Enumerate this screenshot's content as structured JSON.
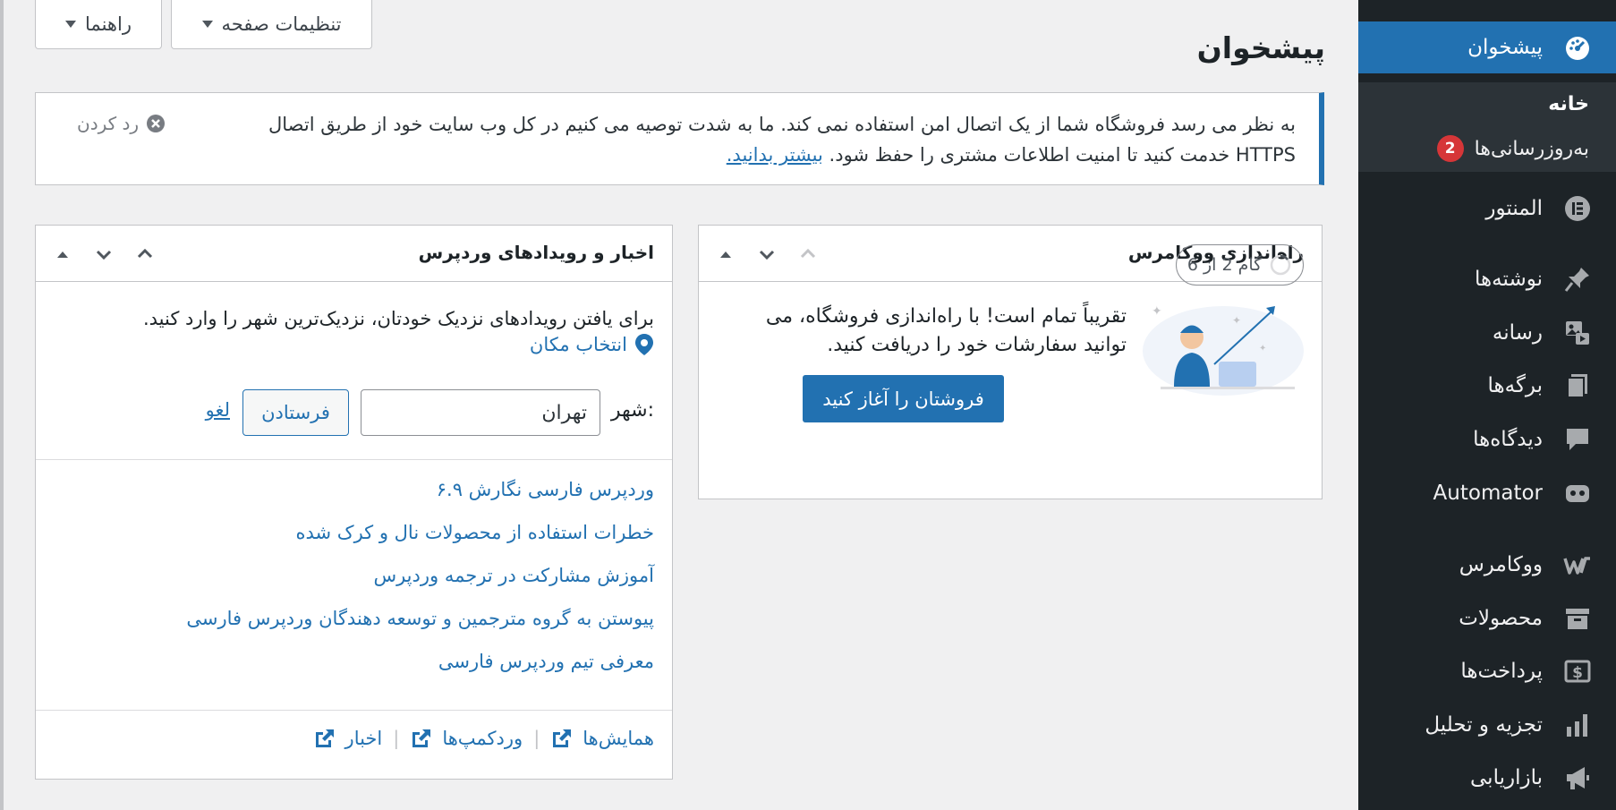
{
  "screen_tabs": {
    "help": "راهنما",
    "screen_options": "تنظیمات صفحه"
  },
  "page_title": "پیشخوان",
  "notice": {
    "line1": "به نظر می رسد فروشگاه شما از یک اتصال امن استفاده نمی کند. ما به شدت توصیه می کنیم در کل وب سایت خود از طریق اتصال",
    "line2": "HTTPS خدمت کنید تا امنیت اطلاعات مشتری را حفظ شود.",
    "learn_more": "بیشتر بدانید.",
    "dismiss": "رد کردن"
  },
  "woo_setup": {
    "title": "راه‌اندازی ووکامرس",
    "step": "گام 2 از 6",
    "message": "تقریباً تمام است! با راه‌اندازی فروشگاه، می توانید سفارشات خود را دریافت کنید.",
    "button": "فروشتان را آغاز کنید"
  },
  "events": {
    "title": "اخبار و رویدادهای وردپرس",
    "intro": "برای یافتن رویدادهای نزدیک خودتان، نزدیک‌ترین شهر را وارد کنید.",
    "choose_location": "انتخاب مکان",
    "city_label": "شهر:",
    "city_value": "تهران",
    "submit": "فرستادن",
    "cancel": "لغو",
    "news": [
      "وردپرس فارسی نگارش ۶.۹",
      "خطرات استفاده از محصولات نال و کرک شده",
      "آموزش مشارکت در ترجمه وردپرس",
      "پیوستن به گروه مترجمین و توسعه دهندگان وردپرس فارسی",
      "معرفی تیم وردپرس فارسی"
    ],
    "footer": {
      "meetups": "همایش‌ها",
      "wordcamps": "وردکمپ‌ها",
      "news": "اخبار"
    }
  },
  "sidebar": {
    "dashboard": "پیشخوان",
    "home": "خانه",
    "updates": "به‌روزرسانی‌ها",
    "updates_count": "2",
    "elementor": "المنتور",
    "posts": "نوشته‌ها",
    "media": "رسانه",
    "pages": "برگه‌ها",
    "comments": "دیدگاه‌ها",
    "automator": "Automator",
    "woocommerce": "ووکامرس",
    "products": "محصولات",
    "payments": "پرداخت‌ها",
    "analytics": "تجزیه و تحلیل",
    "marketing": "بازاریابی"
  },
  "colors": {
    "accent": "#2271b1",
    "sidebar": "#1d2327",
    "badge": "#d63638"
  }
}
